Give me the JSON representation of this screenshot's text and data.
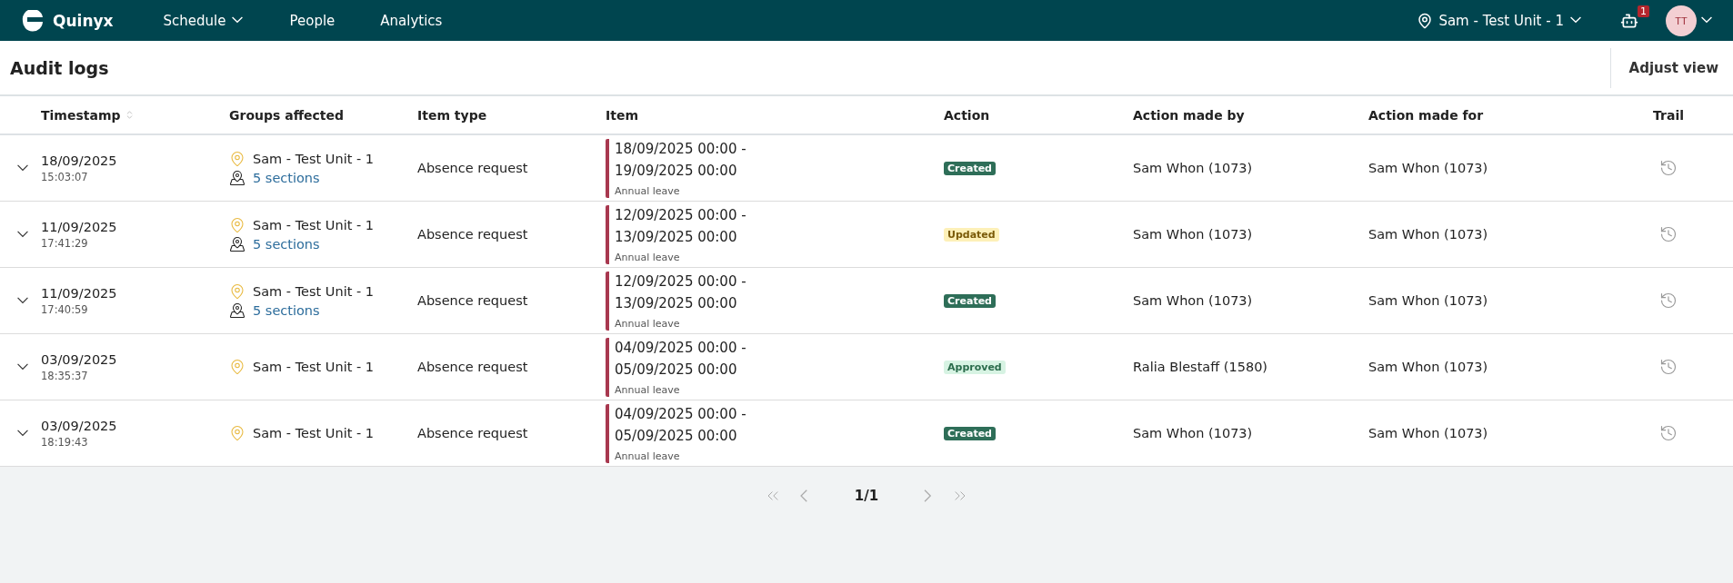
{
  "nav": {
    "logo": "Quinyx",
    "items": [
      {
        "label": "Schedule",
        "dropdown": true
      },
      {
        "label": "People",
        "dropdown": false
      },
      {
        "label": "Analytics",
        "dropdown": false
      }
    ],
    "unit": "Sam - Test Unit - 1",
    "notifications": "1",
    "avatar": "TT"
  },
  "page": {
    "title": "Audit logs",
    "adjust_button": "Adjust view"
  },
  "table": {
    "columns": [
      "Timestamp",
      "Groups affected",
      "Item type",
      "Item",
      "Action",
      "Action made by",
      "Action made for",
      "Trail"
    ],
    "rows": [
      {
        "date": "18/09/2025",
        "time": "15:03:07",
        "group": "Sam - Test Unit - 1",
        "sections": "5 sections",
        "item_type": "Absence request",
        "item_lines": [
          "18/09/2025 00:00 -",
          "19/09/2025 00:00"
        ],
        "item_sub": "Annual leave",
        "action": {
          "label": "Created",
          "kind": "created"
        },
        "made_by": "Sam Whon (1073)",
        "made_for": "Sam Whon (1073)"
      },
      {
        "date": "11/09/2025",
        "time": "17:41:29",
        "group": "Sam - Test Unit - 1",
        "sections": "5 sections",
        "item_type": "Absence request",
        "item_lines": [
          "12/09/2025 00:00 -",
          "13/09/2025 00:00"
        ],
        "item_sub": "Annual leave",
        "action": {
          "label": "Updated",
          "kind": "updated"
        },
        "made_by": "Sam Whon (1073)",
        "made_for": "Sam Whon (1073)"
      },
      {
        "date": "11/09/2025",
        "time": "17:40:59",
        "group": "Sam - Test Unit - 1",
        "sections": "5 sections",
        "item_type": "Absence request",
        "item_lines": [
          "12/09/2025 00:00 -",
          "13/09/2025 00:00"
        ],
        "item_sub": "Annual leave",
        "action": {
          "label": "Created",
          "kind": "created"
        },
        "made_by": "Sam Whon (1073)",
        "made_for": "Sam Whon (1073)"
      },
      {
        "date": "03/09/2025",
        "time": "18:35:37",
        "group": "Sam - Test Unit - 1",
        "item_type": "Absence request",
        "item_lines": [
          "04/09/2025 00:00 -",
          "05/09/2025 00:00"
        ],
        "item_sub": "Annual leave",
        "action": {
          "label": "Approved",
          "kind": "approved"
        },
        "made_by": "Ralia Blestaff (1580)",
        "made_for": "Sam Whon (1073)"
      },
      {
        "date": "03/09/2025",
        "time": "18:19:43",
        "group": "Sam - Test Unit - 1",
        "item_type": "Absence request",
        "item_lines": [
          "04/09/2025 00:00 -",
          "05/09/2025 00:00"
        ],
        "item_sub": "Annual leave",
        "action": {
          "label": "Created",
          "kind": "created"
        },
        "made_by": "Sam Whon (1073)",
        "made_for": "Sam Whon (1073)"
      }
    ]
  },
  "pagination": {
    "page": "1/1"
  }
}
